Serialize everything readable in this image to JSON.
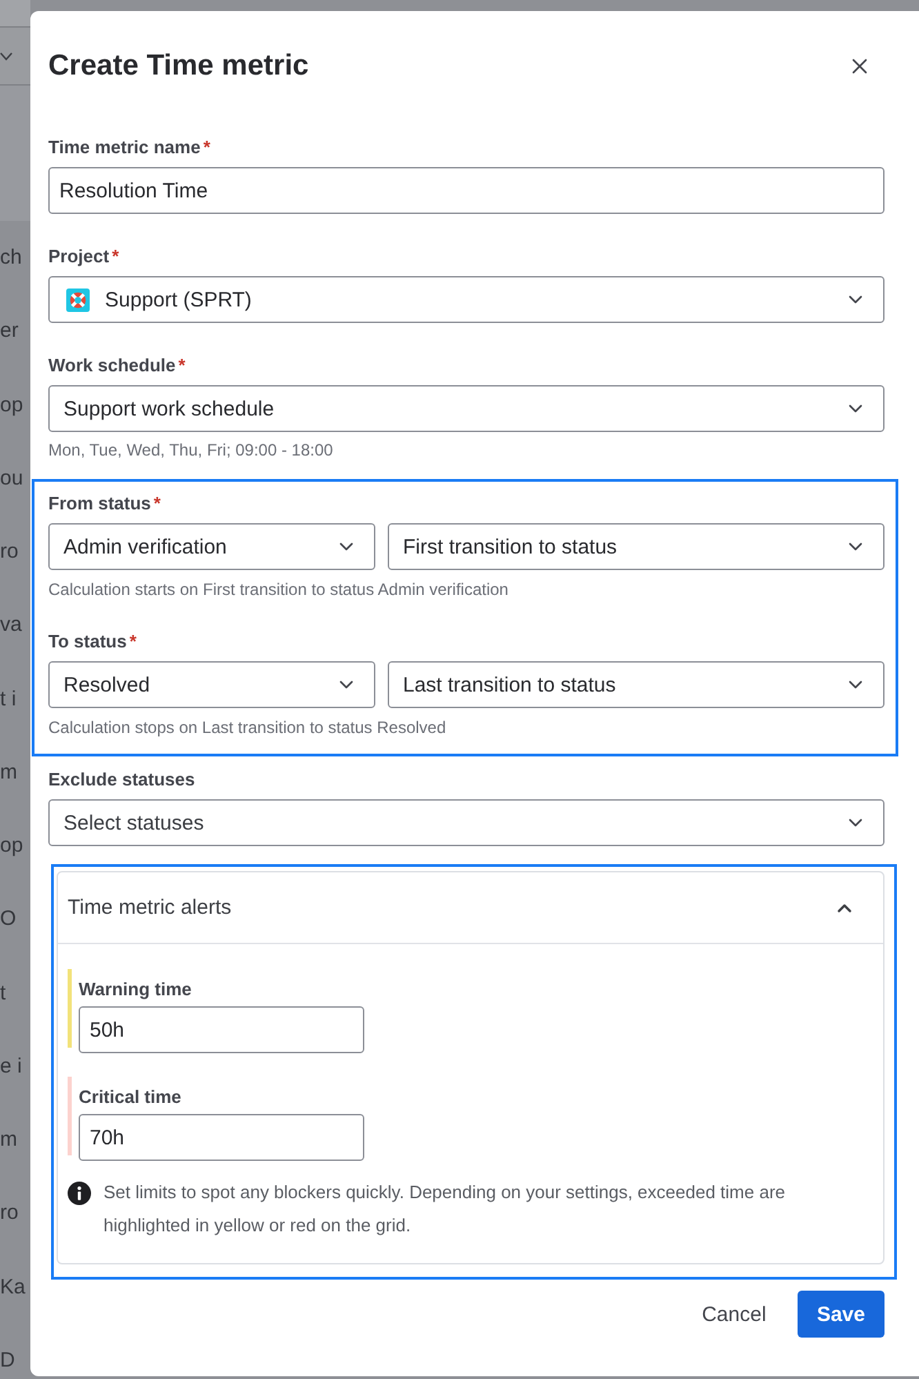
{
  "background_page": {
    "text_fragments": [
      "ch",
      "er",
      "op",
      "ou",
      "ro",
      "va",
      "t i",
      "m",
      "op",
      "O",
      "t",
      "e i",
      "m",
      "ro",
      "Ka",
      "D"
    ]
  },
  "dialog": {
    "title": "Create Time metric"
  },
  "fields": [
    {
      "kind": "text",
      "label": "Time metric name",
      "required_mark": "*",
      "value": "Resolution Time"
    },
    {
      "kind": "project_select",
      "label": "Project",
      "required_mark": "*",
      "value": "Support (SPRT)"
    },
    {
      "kind": "select",
      "label": "Work schedule",
      "required_mark": "*",
      "value": "Support work schedule",
      "helper": "Mon, Tue, Wed, Thu, Fri; 09:00 - 18:00"
    }
  ],
  "status_section": {
    "highlighted": true,
    "rows": [
      {
        "label": "From status",
        "required_mark": "*",
        "status": "Admin verification",
        "transition": "First transition to status",
        "helper": "Calculation starts on First transition to status Admin verification"
      },
      {
        "label": "To status",
        "required_mark": "*",
        "status": "Resolved",
        "transition": "Last transition to status",
        "helper": "Calculation stops on Last transition to status Resolved"
      }
    ]
  },
  "exclude_statuses": {
    "label": "Exclude statuses",
    "placeholder": "Select statuses"
  },
  "alerts": {
    "highlighted": true,
    "title": "Time metric alerts",
    "expanded": true,
    "thresholds": [
      {
        "label": "Warning time",
        "value": "50h",
        "color": "#f2e27a"
      },
      {
        "label": "Critical time",
        "value": "70h",
        "color": "#fcd2ce"
      }
    ],
    "info": "Set limits to spot any blockers quickly. Depending on your settings, exceeded time are highlighted in yellow or red on the grid."
  },
  "footer": {
    "buttons": [
      {
        "kind": "secondary",
        "label": "Cancel"
      },
      {
        "kind": "primary",
        "label": "Save"
      }
    ]
  }
}
